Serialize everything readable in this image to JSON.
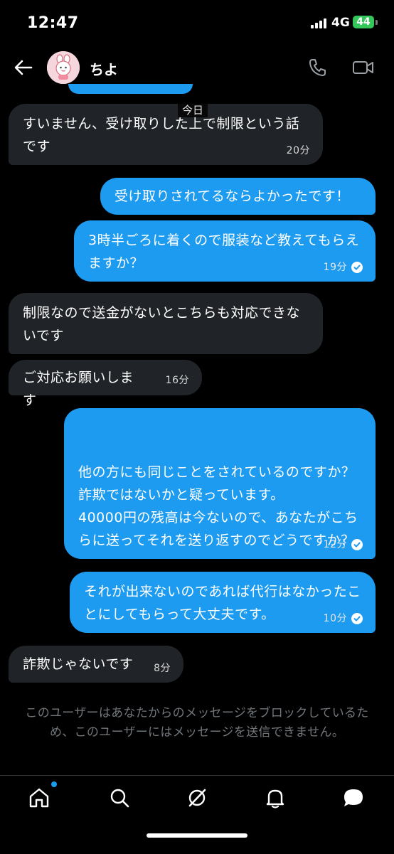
{
  "status_bar": {
    "time": "12:47",
    "network": "4G",
    "battery": "44"
  },
  "header": {
    "contact_name": "ちよ"
  },
  "date_separator": "今日",
  "messages": [
    {
      "side": "in",
      "text": "すいません、受け取りした上で制限という話です",
      "time": "20分"
    },
    {
      "side": "out",
      "text": "受け取りされてるならよかったです！",
      "time": ""
    },
    {
      "side": "out",
      "text": "3時半ごろに着くので服装など教えてもらえますか？",
      "time": "19分"
    },
    {
      "side": "in",
      "text": "制限なので送金がないとこちらも対応できないです",
      "time": ""
    },
    {
      "side": "in",
      "text": "ご対応お願いします",
      "time": "16分"
    },
    {
      "side": "out",
      "text": "他の方にも同じことをされているのですか？\n詐欺ではないかと疑っています。\n40000円の残高は今ないので、あなたがこちらに送ってそれを送り返すのでどうですか？",
      "time": "12分"
    },
    {
      "side": "out",
      "text": "それが出来ないのであれば代行はなかったことにしてもらって大丈夫です。",
      "time": "10分"
    },
    {
      "side": "in",
      "text": "詐欺じゃないです",
      "time": "8分"
    }
  ],
  "blocked_notice": "このユーザーはあなたからのメッセージをブロックしているため、このユーザーにはメッセージを送信できません。",
  "nav": {
    "items": [
      {
        "icon": "home-icon"
      },
      {
        "icon": "search-icon"
      },
      {
        "icon": "grok-icon"
      },
      {
        "icon": "notifications-icon"
      },
      {
        "icon": "messages-icon"
      }
    ]
  },
  "colors": {
    "accent": "#1d9bf0",
    "incoming_bubble": "#202327",
    "background": "#000000",
    "muted_text": "#71767b",
    "battery": "#34c759"
  }
}
